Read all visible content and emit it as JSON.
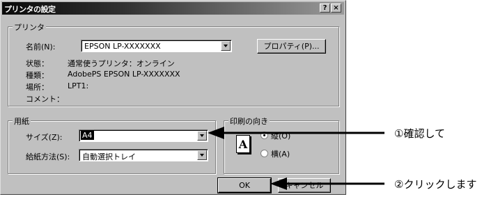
{
  "dialog": {
    "title": "プリンタの設定",
    "help_button": "?",
    "close_button": "×"
  },
  "printer_group": {
    "label": "プリンタ",
    "name_label": "名前(N):",
    "name_value": "EPSON LP-XXXXXXX",
    "properties_button": "プロパティ(P)...",
    "status_label": "状態：",
    "status_value": "通常使うプリンタ：オンライン",
    "type_label": "種類：",
    "type_value": "AdobePS EPSON LP-XXXXXXX",
    "location_label": "場所：",
    "location_value": "LPT1:",
    "comment_label": "コメント："
  },
  "paper_group": {
    "label": "用紙",
    "size_label": "サイズ(Z):",
    "size_value": "A4",
    "source_label": "給紙方法(S):",
    "source_value": "自動選択トレイ"
  },
  "orientation_group": {
    "label": "印刷の向き",
    "portrait_label": "縦(O)",
    "landscape_label": "横(A)",
    "portrait_selected": true,
    "icon_letter": "A"
  },
  "buttons": {
    "ok": "OK",
    "cancel": "キャンセル"
  },
  "callouts": {
    "step1": "①確認して",
    "step2": "②クリックします"
  }
}
